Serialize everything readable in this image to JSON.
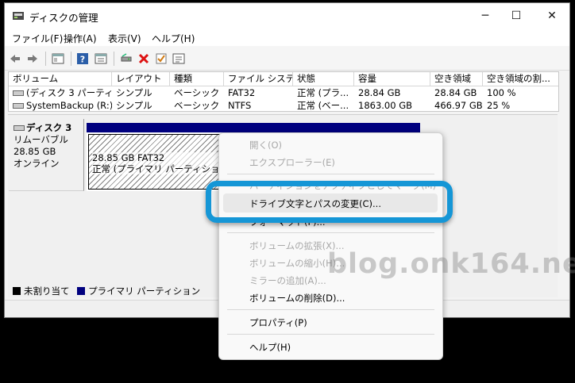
{
  "window": {
    "title": "ディスクの管理",
    "buttons": {
      "minimize": "─",
      "maximize": "☐",
      "close": "✕"
    }
  },
  "menubar": [
    "ファイル(F)",
    "操作(A)",
    "表示(V)",
    "ヘルプ(H)"
  ],
  "toolbar_icons": [
    "back-arrow-icon",
    "forward-arrow-icon",
    "console-tree-icon",
    "help-icon",
    "properties-icon",
    "connect-icon",
    "delete-icon",
    "check-icon",
    "settings-icon"
  ],
  "volume_list": {
    "columns": [
      "ボリューム",
      "レイアウト",
      "種類",
      "ファイル システム",
      "状態",
      "容量",
      "空き領域",
      "空き領域の割..."
    ],
    "rows": [
      [
        "(ディスク 3 パーティシ...",
        "シンプル",
        "ベーシック",
        "FAT32",
        "正常 (プラ...",
        "28.84 GB",
        "28.84 GB",
        "100 %"
      ],
      [
        "SystemBackup (R:)",
        "シンプル",
        "ベーシック",
        "NTFS",
        "正常 (ベー...",
        "1863.00 GB",
        "466.97 GB",
        "25 %"
      ]
    ]
  },
  "disk": {
    "name": "ディスク 3",
    "type": "リムーバブル",
    "size": "28.85 GB",
    "status": "オンライン",
    "partition": {
      "size_fs": "28.85 GB FAT32",
      "status": "正常 (プライマリ パーティション)"
    }
  },
  "legend": [
    {
      "label": "未割り当て",
      "color": "#000000"
    },
    {
      "label": "プライマリ パーティション",
      "color": "#00007f"
    }
  ],
  "context_menu": {
    "groups": [
      [
        {
          "label": "開く(O)",
          "enabled": false
        },
        {
          "label": "エクスプローラー(E)",
          "enabled": false
        }
      ],
      [
        {
          "label": "パーティションをアクティブとしてマーク(M)",
          "enabled": false
        },
        {
          "label": "ドライブ文字とパスの変更(C)...",
          "enabled": true,
          "highlighted": true
        },
        {
          "label": "フォーマット(F)...",
          "enabled": true
        }
      ],
      [
        {
          "label": "ボリュームの拡張(X)...",
          "enabled": false
        },
        {
          "label": "ボリュームの縮小(H)...",
          "enabled": false
        },
        {
          "label": "ミラーの追加(A)...",
          "enabled": false
        },
        {
          "label": "ボリュームの削除(D)...",
          "enabled": true
        }
      ],
      [
        {
          "label": "プロパティ(P)",
          "enabled": true
        }
      ],
      [
        {
          "label": "ヘルプ(H)",
          "enabled": true
        }
      ]
    ]
  },
  "highlight_color": "#1596d6",
  "watermark": "blog.onk164.net"
}
